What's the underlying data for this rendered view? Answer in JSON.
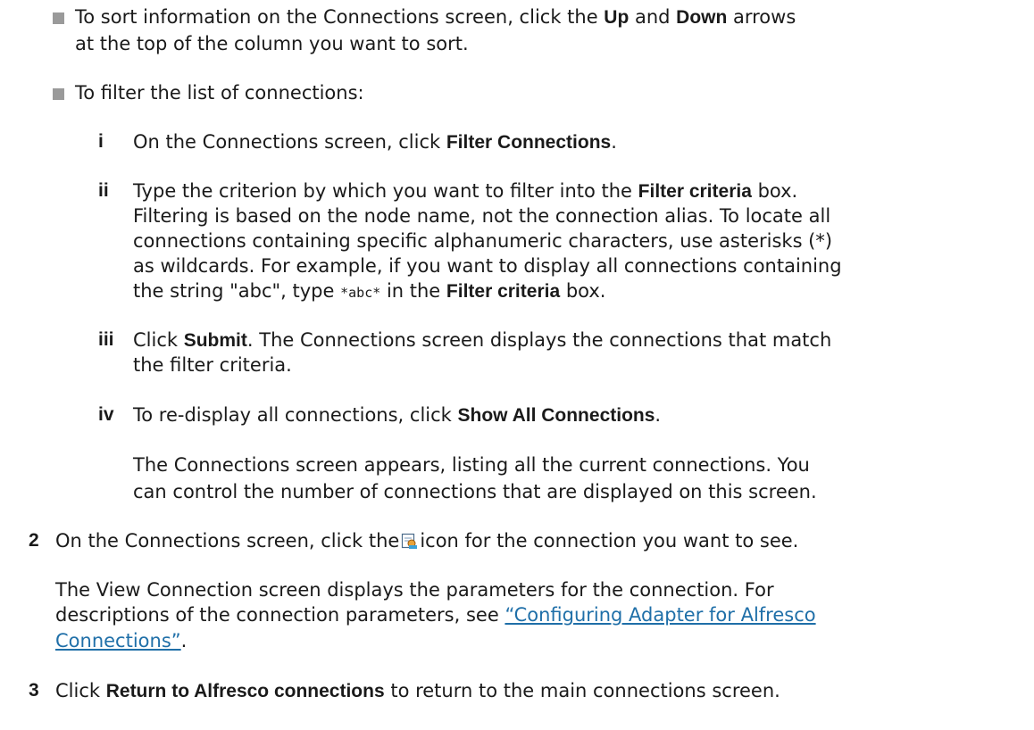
{
  "bullets": {
    "sort": {
      "t1": "To sort information on the Connections screen, click the ",
      "b1": "Up",
      "t2": " and ",
      "b2": "Down",
      "t3": " arrows",
      "line2": "at the top of the column you want to sort."
    },
    "filter": {
      "text": "To filter the list of connections:"
    }
  },
  "substeps": [
    {
      "marker": "i",
      "t1": "On the Connections screen, click ",
      "b1": "Filter Connections",
      "t2": "."
    },
    {
      "marker": "ii",
      "l1_t1": "Type the criterion by which you want to filter into the ",
      "l1_b1": "Filter criteria",
      "l1_t2": " box.",
      "l2": "Filtering is based on the node name, not the connection alias. To locate all",
      "l3": "connections containing specific alphanumeric characters, use asterisks (*)",
      "l4": "as wildcards. For example, if you want to display all connections containing",
      "l5_t1": "the string \"abc\", type ",
      "l5_code": "*abc*",
      "l5_t2": " in the ",
      "l5_b1": "Filter criteria",
      "l5_t3": " box."
    },
    {
      "marker": "iii",
      "l1_t1": "Click ",
      "l1_b1": "Submit",
      "l1_t2": ". The Connections screen displays the connections that match",
      "l2": "the filter criteria."
    },
    {
      "marker": "iv",
      "t1": "To re-display all connections, click ",
      "b1": "Show All Connections",
      "t2": "."
    }
  ],
  "note": {
    "l1": "The Connections screen appears, listing all the current connections. You",
    "l2": "can control the number of connections that are displayed on this screen."
  },
  "steps": [
    {
      "number": "2",
      "t1": "On the Connections screen, click the",
      "icon": "view-connection-icon",
      "t2": "icon for the connection you want to see.",
      "desc_l1": "The View Connection screen displays the parameters for the connection. For",
      "desc_l2_t1": "descriptions of the connection parameters, see ",
      "link_l1": "“Configuring Adapter for Alfresco",
      "link_l2": "Connections”",
      "desc_end": "."
    },
    {
      "number": "3",
      "t1": "Click ",
      "b1": "Return to Alfresco connections",
      "t2": " to return to the main connections screen."
    }
  ]
}
